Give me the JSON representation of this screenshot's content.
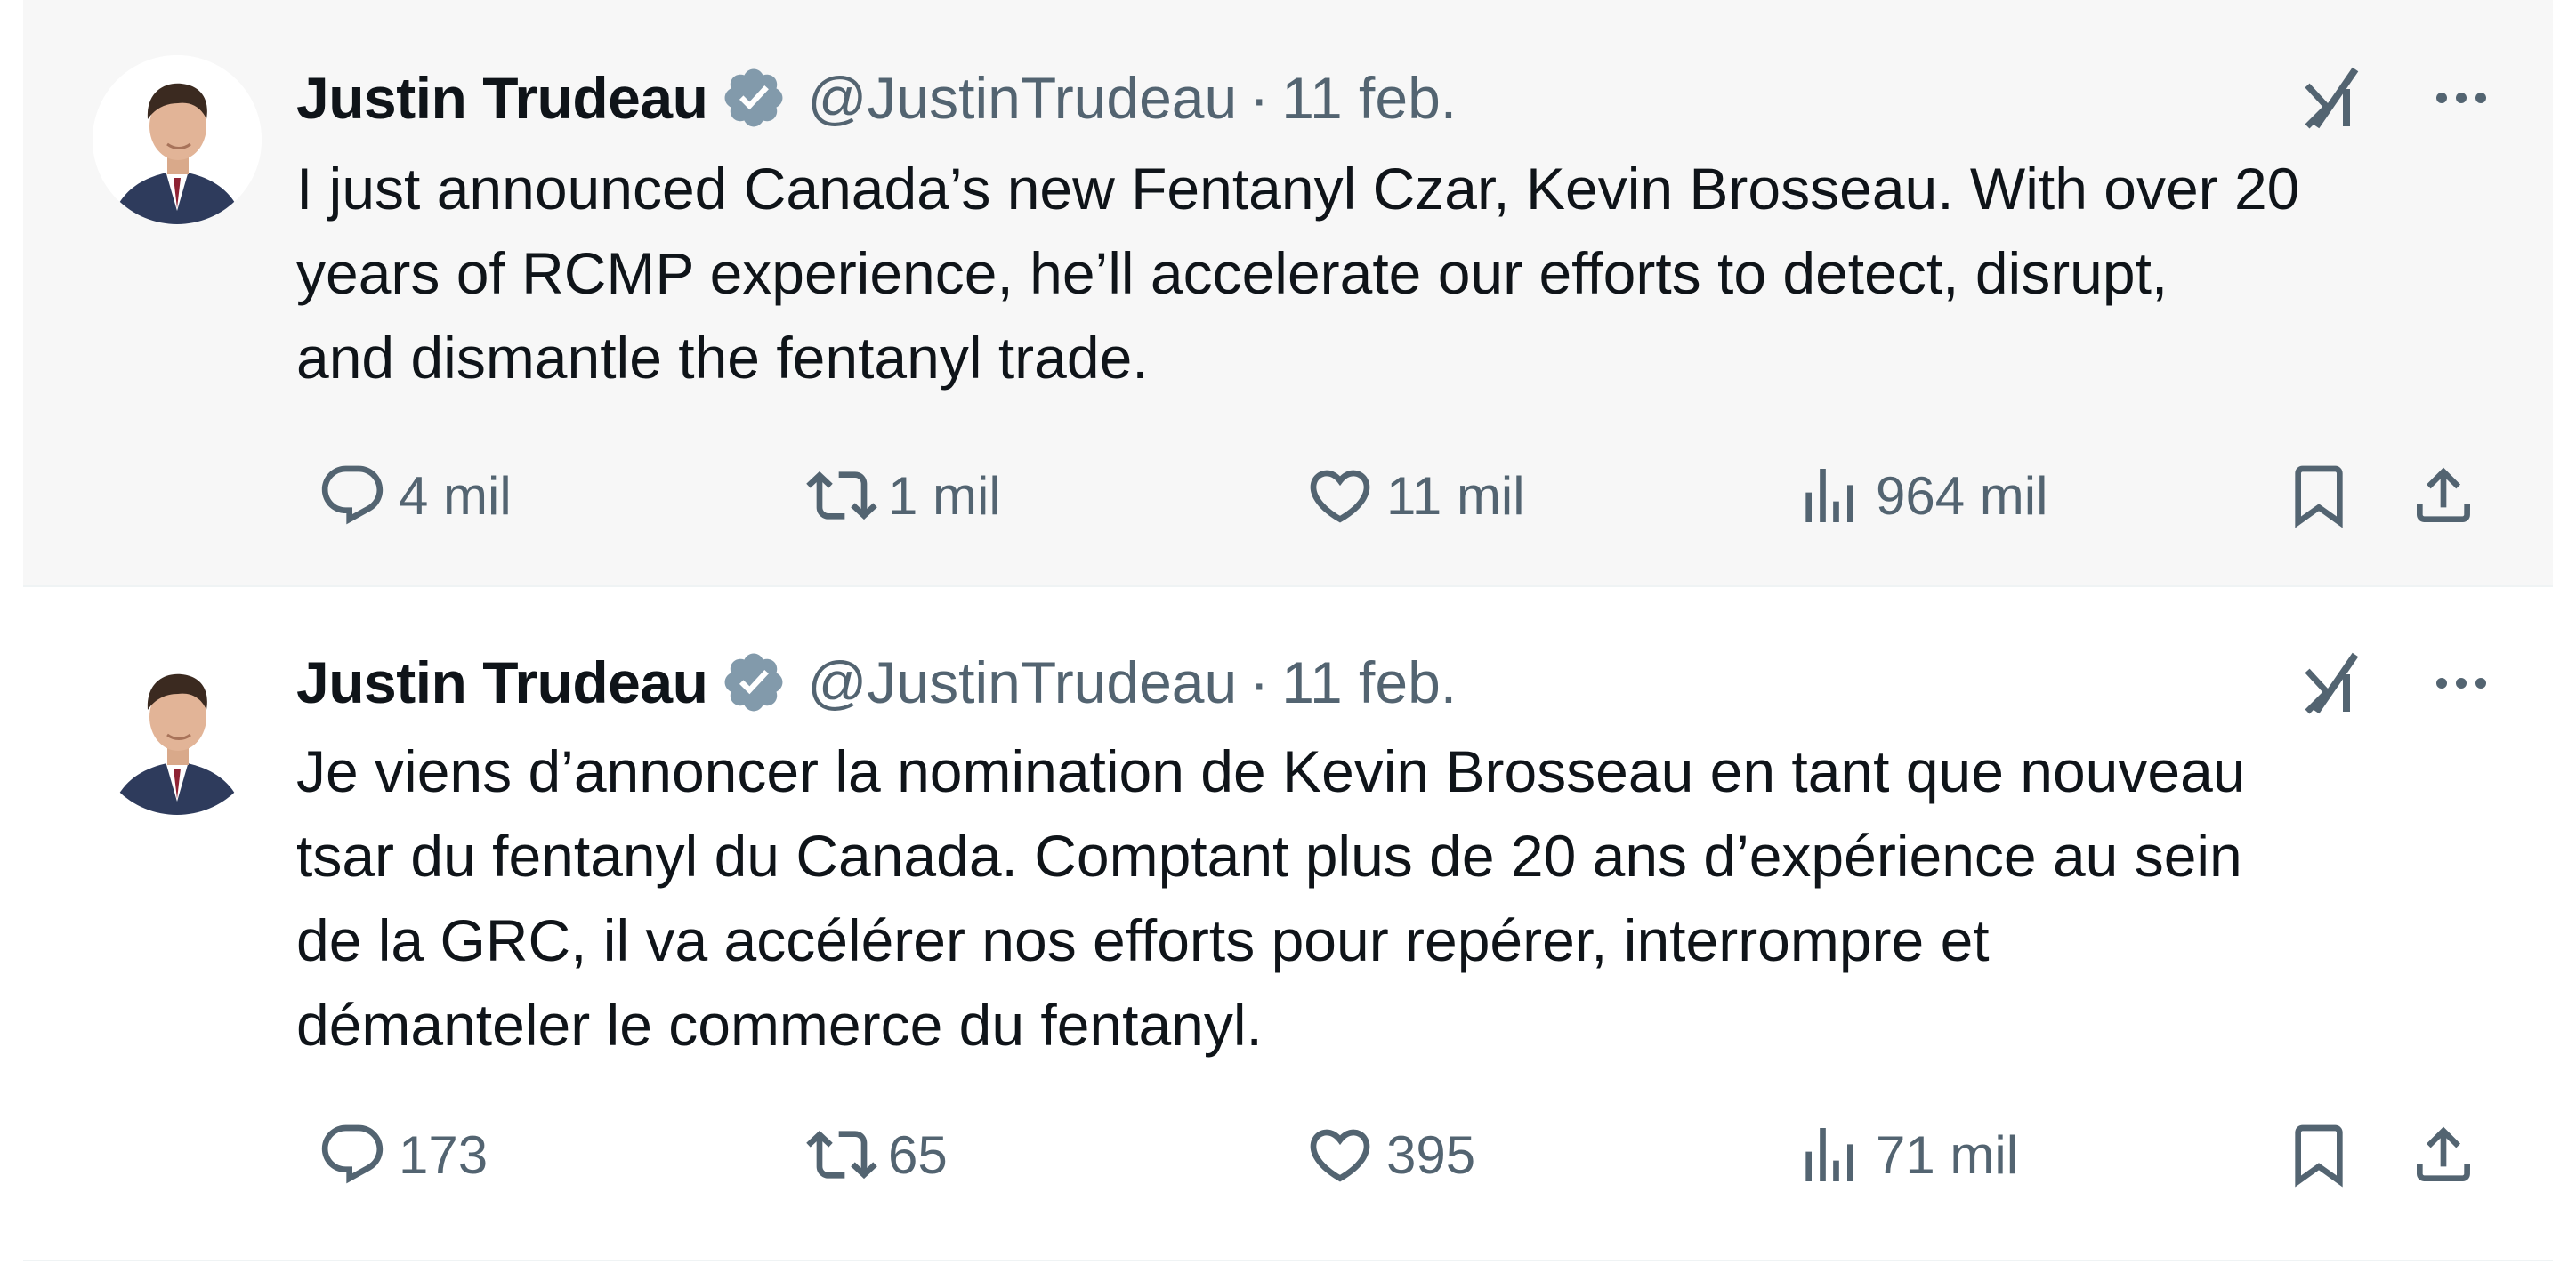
{
  "tweets": [
    {
      "author": "Justin Trudeau",
      "handle": "@JustinTrudeau",
      "separator": "·",
      "date": "11 feb.",
      "text": "I just announced Canada’s new Fentanyl Czar, Kevin Brosseau. With over 20\nyears of RCMP experience, he’ll accelerate our efforts to detect, disrupt,\nand dismantle the fentanyl trade.",
      "replies": "4 mil",
      "reposts": "1 mil",
      "likes": "11 mil",
      "views": "964 mil"
    },
    {
      "author": "Justin Trudeau",
      "handle": "@JustinTrudeau",
      "separator": "·",
      "date": "11 feb.",
      "text": "Je viens d’annoncer la nomination de Kevin Brosseau en tant que nouveau\ntsar du fentanyl du Canada. Comptant plus de 20 ans d’expérience au sein\nde la GRC, il va accélérer nos efforts pour repérer, interrompre et\ndémanteler le commerce du fentanyl.",
      "replies": "173",
      "reposts": "65",
      "likes": "395",
      "views": "71 mil"
    }
  ],
  "icons": {
    "avatar": "avatar-photo",
    "verified": "verified-badge-icon",
    "grok": "grok-icon",
    "more": "more-icon",
    "reply": "reply-icon",
    "repost": "repost-icon",
    "like": "like-icon",
    "views": "views-icon",
    "bookmark": "bookmark-icon",
    "share": "share-icon"
  },
  "colors": {
    "text": "#0f1419",
    "muted": "#536471",
    "verified_badge": "#829aab",
    "highlight_bg": "#f7f7f7"
  }
}
